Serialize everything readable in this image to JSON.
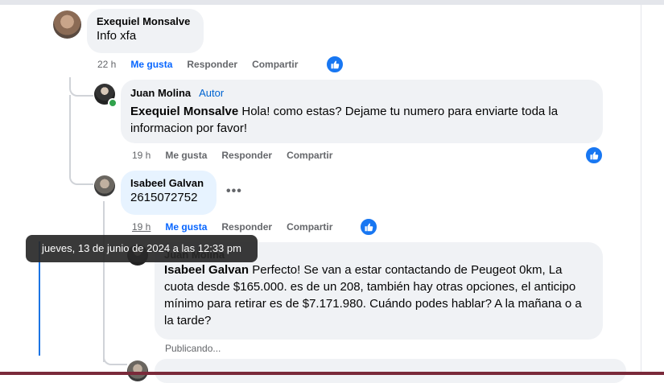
{
  "comments": [
    {
      "author": "Exequiel Monsalve",
      "text": "Info xfa",
      "actions": {
        "time": "22 h",
        "like": "Me gusta",
        "reply": "Responder",
        "share": "Compartir"
      }
    },
    {
      "author": "Juan Molina",
      "badge": "Autor",
      "mention": "Exequiel Monsalve",
      "text": " Hola! como estas? Dejame tu numero para enviarte toda la informacion por favor!",
      "actions": {
        "time": "19 h",
        "like": "Me gusta",
        "reply": "Responder",
        "share": "Compartir"
      }
    },
    {
      "author": "Isabeel Galvan",
      "text": "2615072752",
      "more": "•••",
      "actions": {
        "time": "19 h",
        "like": "Me gusta",
        "reply": "Responder",
        "share": "Compartir"
      }
    },
    {
      "author": "Juan Molina",
      "mention": "Isabeel Galvan",
      "text": " Perfecto! Se van a estar contactando de Peugeot 0km, La cuota desde $165.000. es de un 208, también hay otras opciones, el anticipo mínimo para retirar es de $7.171.980. Cuándo podes hablar? A la mañana o a la tarde?",
      "status": "Publicando..."
    }
  ],
  "tooltip": "jueves, 13 de junio de 2024 a las 12:33 pm",
  "colors": {
    "accent": "#0866ff",
    "bubble": "#f0f2f5",
    "highlight": "#e7f3ff"
  },
  "icons": [
    "like-thumb-icon",
    "more-icon",
    "online-dot"
  ]
}
